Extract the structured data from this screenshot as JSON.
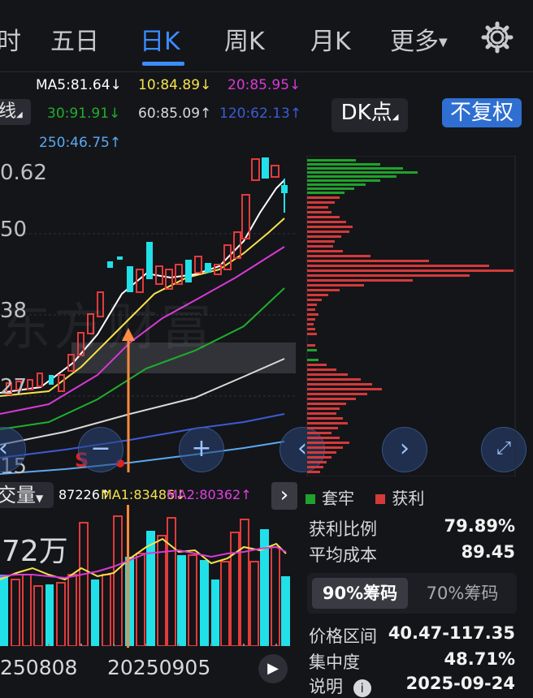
{
  "tabs": {
    "items": [
      {
        "label": "时"
      },
      {
        "label": "五日"
      },
      {
        "label": "日K"
      },
      {
        "label": "周K"
      },
      {
        "label": "月K"
      },
      {
        "label": "更多"
      }
    ],
    "active_index": 2
  },
  "ma_row1": {
    "ma5": "MA5:81.64↓",
    "ma10": "10:84.89↓",
    "ma20": "20:85.95↓"
  },
  "ma_row2": {
    "ma30": "30:91.91↓",
    "ma60": "60:85.09↑",
    "ma120": "120:62.13↑"
  },
  "ma_row3": {
    "ma250": "250:46.75↑"
  },
  "line_selector": "线",
  "dk_button": "DK点",
  "fq_button": "不复权",
  "price_axis": [
    "0.62",
    "50",
    "38",
    "27",
    "15"
  ],
  "watermark": "东方财富",
  "marker_s": "S",
  "volume_bar": {
    "label": "交量",
    "value": "87226↑",
    "ma1": "MA1:83486↓",
    "ma2": "MA2:80362↑"
  },
  "volume_axis": "72万",
  "dates": [
    "250808",
    "20250905"
  ],
  "chip_legend": {
    "trapped": "套牢",
    "profit": "获利"
  },
  "stats": {
    "profit_ratio_label": "获利比例",
    "profit_ratio_value": "79.89%",
    "avg_cost_label": "平均成本",
    "avg_cost_value": "89.45"
  },
  "chip_tabs": {
    "tab90": "90%筹码",
    "tab70": "70%筹码"
  },
  "stats2": {
    "range_label": "价格区间",
    "range_value": "40.47-117.35",
    "concentration_label": "集中度",
    "concentration_value": "48.71%",
    "note_label": "说明",
    "note_value": "2025-09-24"
  },
  "colors": {
    "up": "#e23b3b",
    "down": "#21e0e8",
    "ma5": "#ffffff",
    "ma10": "#f5e34a",
    "ma20": "#d63ad6",
    "ma30": "#1fae2d",
    "ma60": "#d9d9d9",
    "ma120": "#3c5bd6",
    "ma250": "#5aa9f0",
    "accent": "#3b8dff",
    "chip_profit": "#d43a3a",
    "chip_trapped": "#1fa22c"
  }
}
